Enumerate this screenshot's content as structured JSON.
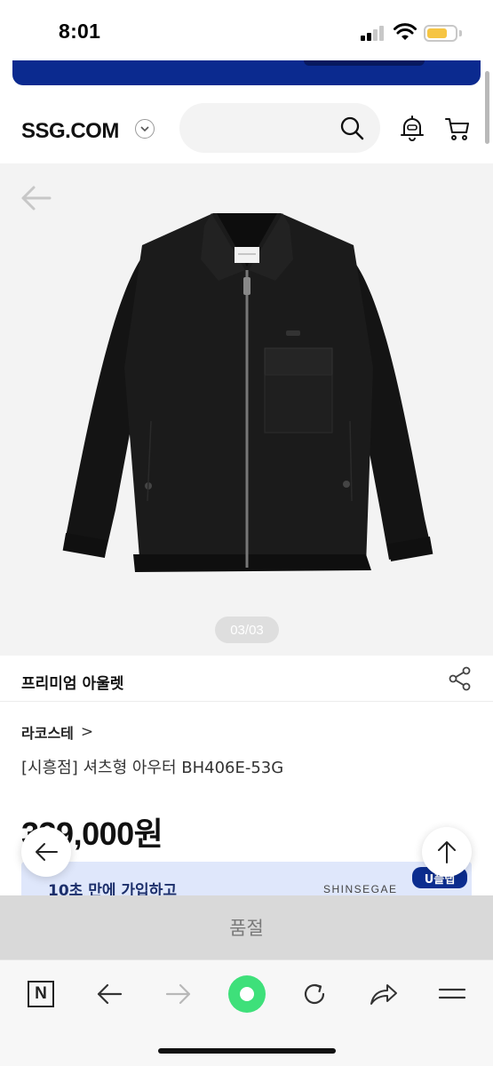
{
  "status_bar": {
    "time": "8:01",
    "signal_icon": "cellular-signal-icon",
    "wifi_icon": "wifi-icon",
    "battery_icon": "battery-icon",
    "battery_color": "#f6c543"
  },
  "header": {
    "logo": "SSG.COM",
    "logo_dropdown_icon": "chevron-down-icon",
    "search_placeholder": "",
    "search_icon": "search-icon",
    "notification_icon": "bell-icon",
    "cart_icon": "cart-icon"
  },
  "product": {
    "image_back_icon": "arrow-left-icon",
    "image_page": "03/03",
    "category": "프리미엄 아울렛",
    "share_icon": "share-icon",
    "brand": "라코스테",
    "brand_chevron": ">",
    "title": "[시흥점] 셔츠형 아우터 BH406E-53G",
    "price": "339,000원"
  },
  "promo": {
    "text": "10초 만에 가입하고",
    "brand": "SHINSEGAE",
    "badge": "U플랩",
    "bg_color": "#dfe7fb",
    "badge_color": "#0b2d8f"
  },
  "floating": {
    "back_icon": "arrow-left-icon",
    "top_icon": "arrow-up-icon"
  },
  "action": {
    "soldout_label": "품절"
  },
  "browser_toolbar": {
    "home_label": "N",
    "items": [
      "naver-home-icon",
      "back-icon",
      "forward-icon",
      "green-dot-icon",
      "refresh-icon",
      "share-icon",
      "menu-icon"
    ]
  },
  "colors": {
    "banner": "#0b2a8f",
    "green_dot": "#3ee07a",
    "soldout_bg": "#d9d9d9"
  }
}
